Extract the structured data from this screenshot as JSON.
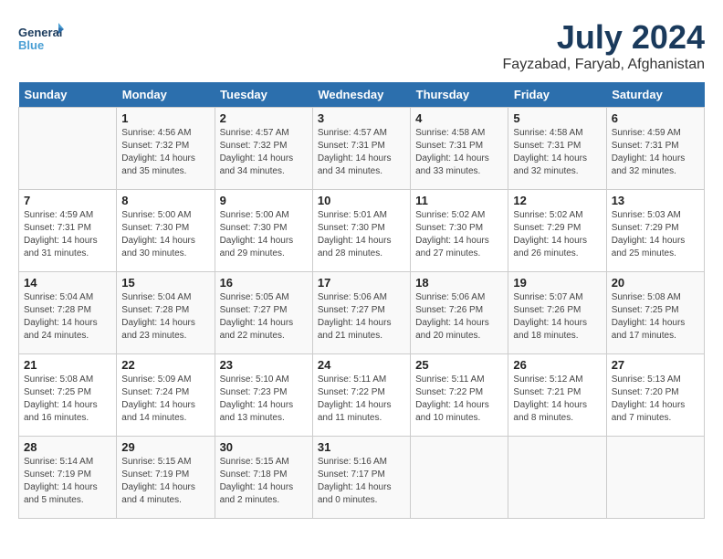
{
  "header": {
    "logo_general": "General",
    "logo_blue": "Blue",
    "month_year": "July 2024",
    "location": "Fayzabad, Faryab, Afghanistan"
  },
  "days_of_week": [
    "Sunday",
    "Monday",
    "Tuesday",
    "Wednesday",
    "Thursday",
    "Friday",
    "Saturday"
  ],
  "weeks": [
    [
      {
        "day": "",
        "empty": true
      },
      {
        "day": "1",
        "sunrise": "4:56 AM",
        "sunset": "7:32 PM",
        "daylight": "14 hours and 35 minutes."
      },
      {
        "day": "2",
        "sunrise": "4:57 AM",
        "sunset": "7:32 PM",
        "daylight": "14 hours and 34 minutes."
      },
      {
        "day": "3",
        "sunrise": "4:57 AM",
        "sunset": "7:31 PM",
        "daylight": "14 hours and 34 minutes."
      },
      {
        "day": "4",
        "sunrise": "4:58 AM",
        "sunset": "7:31 PM",
        "daylight": "14 hours and 33 minutes."
      },
      {
        "day": "5",
        "sunrise": "4:58 AM",
        "sunset": "7:31 PM",
        "daylight": "14 hours and 32 minutes."
      },
      {
        "day": "6",
        "sunrise": "4:59 AM",
        "sunset": "7:31 PM",
        "daylight": "14 hours and 32 minutes."
      }
    ],
    [
      {
        "day": "7",
        "sunrise": "4:59 AM",
        "sunset": "7:31 PM",
        "daylight": "14 hours and 31 minutes."
      },
      {
        "day": "8",
        "sunrise": "5:00 AM",
        "sunset": "7:30 PM",
        "daylight": "14 hours and 30 minutes."
      },
      {
        "day": "9",
        "sunrise": "5:00 AM",
        "sunset": "7:30 PM",
        "daylight": "14 hours and 29 minutes."
      },
      {
        "day": "10",
        "sunrise": "5:01 AM",
        "sunset": "7:30 PM",
        "daylight": "14 hours and 28 minutes."
      },
      {
        "day": "11",
        "sunrise": "5:02 AM",
        "sunset": "7:30 PM",
        "daylight": "14 hours and 27 minutes."
      },
      {
        "day": "12",
        "sunrise": "5:02 AM",
        "sunset": "7:29 PM",
        "daylight": "14 hours and 26 minutes."
      },
      {
        "day": "13",
        "sunrise": "5:03 AM",
        "sunset": "7:29 PM",
        "daylight": "14 hours and 25 minutes."
      }
    ],
    [
      {
        "day": "14",
        "sunrise": "5:04 AM",
        "sunset": "7:28 PM",
        "daylight": "14 hours and 24 minutes."
      },
      {
        "day": "15",
        "sunrise": "5:04 AM",
        "sunset": "7:28 PM",
        "daylight": "14 hours and 23 minutes."
      },
      {
        "day": "16",
        "sunrise": "5:05 AM",
        "sunset": "7:27 PM",
        "daylight": "14 hours and 22 minutes."
      },
      {
        "day": "17",
        "sunrise": "5:06 AM",
        "sunset": "7:27 PM",
        "daylight": "14 hours and 21 minutes."
      },
      {
        "day": "18",
        "sunrise": "5:06 AM",
        "sunset": "7:26 PM",
        "daylight": "14 hours and 20 minutes."
      },
      {
        "day": "19",
        "sunrise": "5:07 AM",
        "sunset": "7:26 PM",
        "daylight": "14 hours and 18 minutes."
      },
      {
        "day": "20",
        "sunrise": "5:08 AM",
        "sunset": "7:25 PM",
        "daylight": "14 hours and 17 minutes."
      }
    ],
    [
      {
        "day": "21",
        "sunrise": "5:08 AM",
        "sunset": "7:25 PM",
        "daylight": "14 hours and 16 minutes."
      },
      {
        "day": "22",
        "sunrise": "5:09 AM",
        "sunset": "7:24 PM",
        "daylight": "14 hours and 14 minutes."
      },
      {
        "day": "23",
        "sunrise": "5:10 AM",
        "sunset": "7:23 PM",
        "daylight": "14 hours and 13 minutes."
      },
      {
        "day": "24",
        "sunrise": "5:11 AM",
        "sunset": "7:22 PM",
        "daylight": "14 hours and 11 minutes."
      },
      {
        "day": "25",
        "sunrise": "5:11 AM",
        "sunset": "7:22 PM",
        "daylight": "14 hours and 10 minutes."
      },
      {
        "day": "26",
        "sunrise": "5:12 AM",
        "sunset": "7:21 PM",
        "daylight": "14 hours and 8 minutes."
      },
      {
        "day": "27",
        "sunrise": "5:13 AM",
        "sunset": "7:20 PM",
        "daylight": "14 hours and 7 minutes."
      }
    ],
    [
      {
        "day": "28",
        "sunrise": "5:14 AM",
        "sunset": "7:19 PM",
        "daylight": "14 hours and 5 minutes."
      },
      {
        "day": "29",
        "sunrise": "5:15 AM",
        "sunset": "7:19 PM",
        "daylight": "14 hours and 4 minutes."
      },
      {
        "day": "30",
        "sunrise": "5:15 AM",
        "sunset": "7:18 PM",
        "daylight": "14 hours and 2 minutes."
      },
      {
        "day": "31",
        "sunrise": "5:16 AM",
        "sunset": "7:17 PM",
        "daylight": "14 hours and 0 minutes."
      },
      {
        "day": "",
        "empty": true
      },
      {
        "day": "",
        "empty": true
      },
      {
        "day": "",
        "empty": true
      }
    ]
  ]
}
